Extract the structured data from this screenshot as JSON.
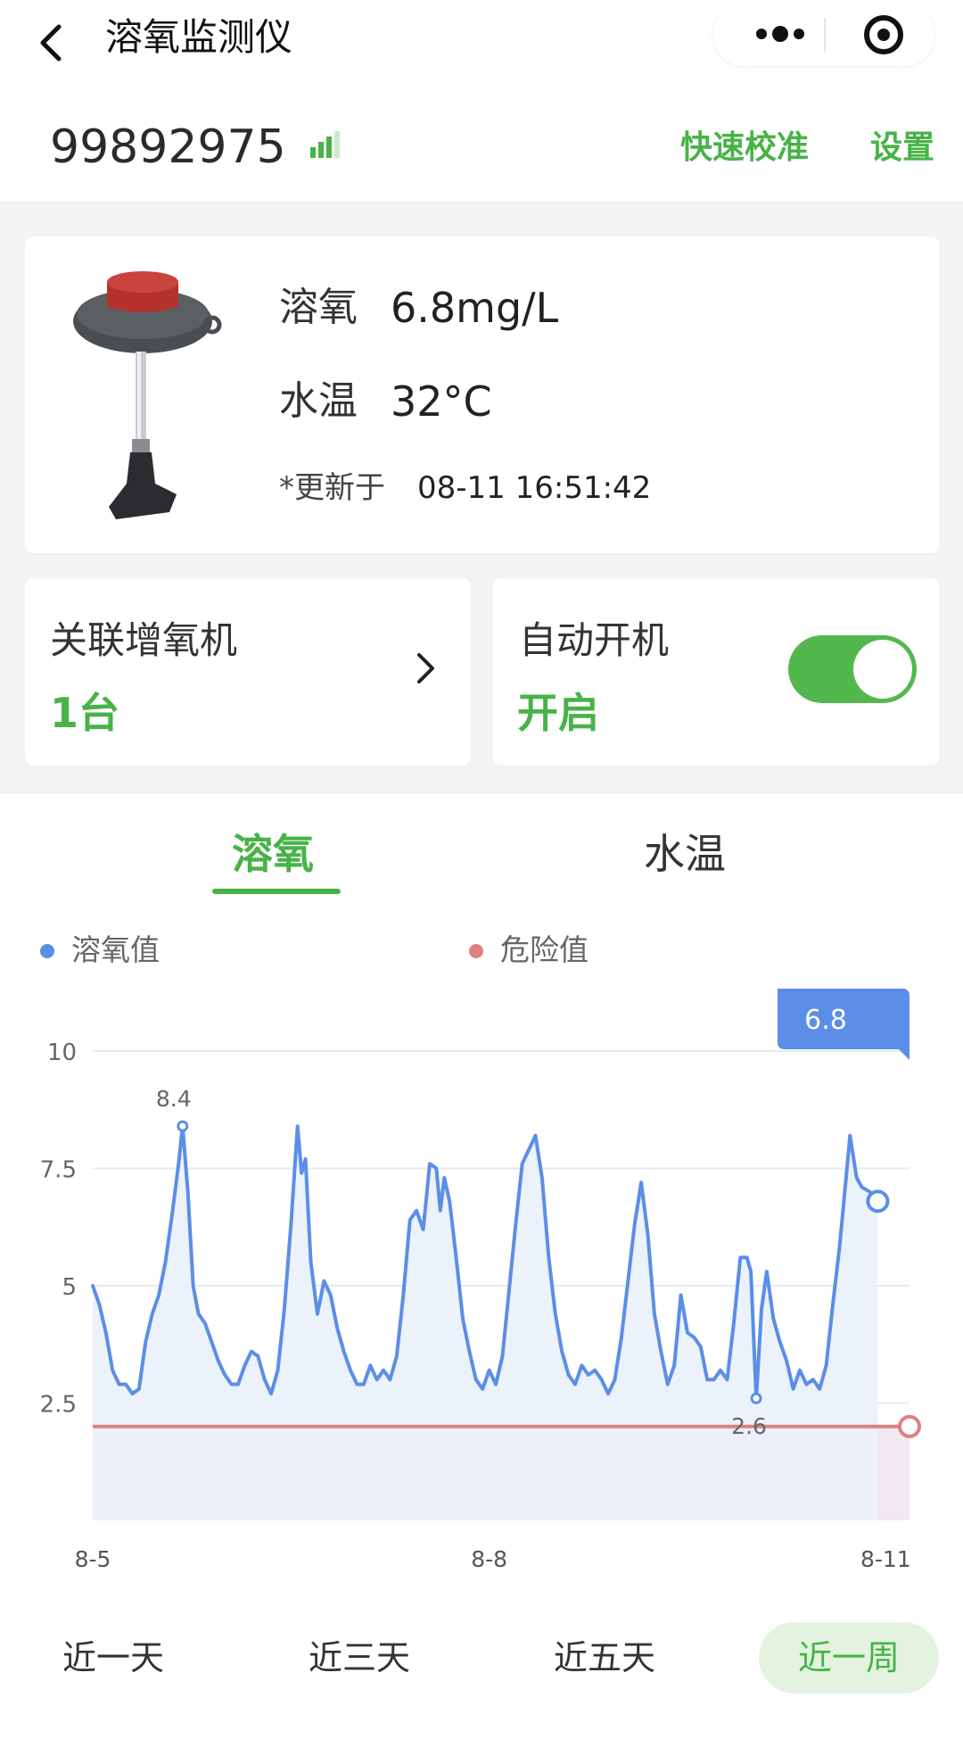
{
  "nav": {
    "title": "溶氧监测仪",
    "icons": [
      "chevron-left-icon",
      "more-dots-icon",
      "target-close-icon"
    ]
  },
  "device": {
    "id": "99892975",
    "signal_icon": "signal-bars-icon",
    "quick_calibration": "快速校准",
    "settings": "设置"
  },
  "readings": {
    "do_label": "溶氧",
    "do_value": "6.8mg/L",
    "temp_label": "水温",
    "temp_value": "32°C",
    "updated_label": "*更新于",
    "updated_time": "08-11 16:51:42"
  },
  "aerator": {
    "title": "关联增氧机",
    "value": "1台"
  },
  "auto_start": {
    "title": "自动开机",
    "value": "开启",
    "enabled": true
  },
  "tabs": [
    {
      "label": "溶氧",
      "active": true
    },
    {
      "label": "水温",
      "active": false
    }
  ],
  "ranges": [
    {
      "label": "近一天",
      "active": false
    },
    {
      "label": "近三天",
      "active": false
    },
    {
      "label": "近五天",
      "active": false
    },
    {
      "label": "近一周",
      "active": true
    }
  ],
  "colors": {
    "accent": "#47b347",
    "series": "#5b8ee6",
    "danger": "#e08080",
    "toggle_on": "#52b84e"
  },
  "chart_data": {
    "type": "line",
    "legend": [
      "溶氧值",
      "危险值"
    ],
    "yticks": [
      "10",
      "7.5",
      "5",
      "2.5"
    ],
    "ylim": [
      0,
      10
    ],
    "xticks": [
      {
        "label": "8-5",
        "t": 0
      },
      {
        "label": "8-8",
        "t": 3
      },
      {
        "label": "8-11",
        "t": 6
      }
    ],
    "xlim": [
      0,
      6.18
    ],
    "tooltip": "6.8",
    "peak_label": "8.4",
    "min_label": "2.6",
    "series": [
      {
        "name": "溶氧值",
        "points": [
          [
            0.0,
            5.0
          ],
          [
            0.05,
            4.6
          ],
          [
            0.1,
            4.0
          ],
          [
            0.15,
            3.2
          ],
          [
            0.2,
            2.9
          ],
          [
            0.25,
            2.9
          ],
          [
            0.3,
            2.7
          ],
          [
            0.35,
            2.8
          ],
          [
            0.4,
            3.8
          ],
          [
            0.45,
            4.4
          ],
          [
            0.5,
            4.8
          ],
          [
            0.55,
            5.5
          ],
          [
            0.6,
            6.5
          ],
          [
            0.65,
            7.6
          ],
          [
            0.68,
            8.4
          ],
          [
            0.72,
            7.0
          ],
          [
            0.76,
            5.0
          ],
          [
            0.8,
            4.4
          ],
          [
            0.85,
            4.2
          ],
          [
            0.9,
            3.8
          ],
          [
            0.95,
            3.4
          ],
          [
            1.0,
            3.1
          ],
          [
            1.05,
            2.9
          ],
          [
            1.1,
            2.9
          ],
          [
            1.15,
            3.3
          ],
          [
            1.2,
            3.6
          ],
          [
            1.25,
            3.5
          ],
          [
            1.3,
            3.0
          ],
          [
            1.35,
            2.7
          ],
          [
            1.4,
            3.2
          ],
          [
            1.45,
            4.5
          ],
          [
            1.5,
            6.3
          ],
          [
            1.55,
            8.4
          ],
          [
            1.58,
            7.4
          ],
          [
            1.61,
            7.7
          ],
          [
            1.65,
            5.5
          ],
          [
            1.7,
            4.4
          ],
          [
            1.75,
            5.1
          ],
          [
            1.8,
            4.8
          ],
          [
            1.85,
            4.1
          ],
          [
            1.9,
            3.6
          ],
          [
            1.95,
            3.2
          ],
          [
            2.0,
            2.9
          ],
          [
            2.05,
            2.9
          ],
          [
            2.1,
            3.3
          ],
          [
            2.15,
            3.0
          ],
          [
            2.2,
            3.2
          ],
          [
            2.25,
            3.0
          ],
          [
            2.3,
            3.5
          ],
          [
            2.35,
            4.8
          ],
          [
            2.4,
            6.4
          ],
          [
            2.45,
            6.6
          ],
          [
            2.5,
            6.2
          ],
          [
            2.55,
            7.6
          ],
          [
            2.6,
            7.5
          ],
          [
            2.63,
            6.6
          ],
          [
            2.66,
            7.3
          ],
          [
            2.7,
            6.8
          ],
          [
            2.75,
            5.6
          ],
          [
            2.8,
            4.3
          ],
          [
            2.85,
            3.6
          ],
          [
            2.9,
            3.0
          ],
          [
            2.95,
            2.8
          ],
          [
            3.0,
            3.2
          ],
          [
            3.05,
            2.9
          ],
          [
            3.1,
            3.5
          ],
          [
            3.15,
            4.9
          ],
          [
            3.2,
            6.3
          ],
          [
            3.25,
            7.6
          ],
          [
            3.3,
            7.9
          ],
          [
            3.35,
            8.2
          ],
          [
            3.4,
            7.3
          ],
          [
            3.45,
            5.6
          ],
          [
            3.5,
            4.4
          ],
          [
            3.55,
            3.6
          ],
          [
            3.6,
            3.1
          ],
          [
            3.65,
            2.9
          ],
          [
            3.7,
            3.3
          ],
          [
            3.75,
            3.1
          ],
          [
            3.8,
            3.2
          ],
          [
            3.85,
            3.0
          ],
          [
            3.9,
            2.7
          ],
          [
            3.95,
            3.0
          ],
          [
            4.0,
            3.9
          ],
          [
            4.05,
            5.1
          ],
          [
            4.1,
            6.3
          ],
          [
            4.15,
            7.2
          ],
          [
            4.2,
            6.1
          ],
          [
            4.25,
            4.4
          ],
          [
            4.3,
            3.6
          ],
          [
            4.35,
            2.9
          ],
          [
            4.4,
            3.3
          ],
          [
            4.45,
            4.8
          ],
          [
            4.5,
            4.0
          ],
          [
            4.55,
            3.9
          ],
          [
            4.6,
            3.7
          ],
          [
            4.65,
            3.0
          ],
          [
            4.7,
            3.0
          ],
          [
            4.75,
            3.2
          ],
          [
            4.8,
            3.0
          ],
          [
            4.85,
            4.2
          ],
          [
            4.9,
            5.6
          ],
          [
            4.95,
            5.6
          ],
          [
            4.98,
            5.3
          ],
          [
            5.02,
            2.6
          ],
          [
            5.06,
            4.5
          ],
          [
            5.1,
            5.3
          ],
          [
            5.15,
            4.3
          ],
          [
            5.2,
            3.8
          ],
          [
            5.25,
            3.4
          ],
          [
            5.3,
            2.8
          ],
          [
            5.35,
            3.2
          ],
          [
            5.4,
            2.9
          ],
          [
            5.45,
            3.0
          ],
          [
            5.5,
            2.8
          ],
          [
            5.55,
            3.3
          ],
          [
            5.6,
            4.6
          ],
          [
            5.65,
            5.8
          ],
          [
            5.7,
            7.3
          ],
          [
            5.73,
            8.2
          ],
          [
            5.78,
            7.3
          ],
          [
            5.82,
            7.1
          ],
          [
            5.88,
            7.0
          ],
          [
            5.94,
            6.8
          ]
        ]
      },
      {
        "name": "危险值",
        "value": 2.0
      }
    ]
  }
}
